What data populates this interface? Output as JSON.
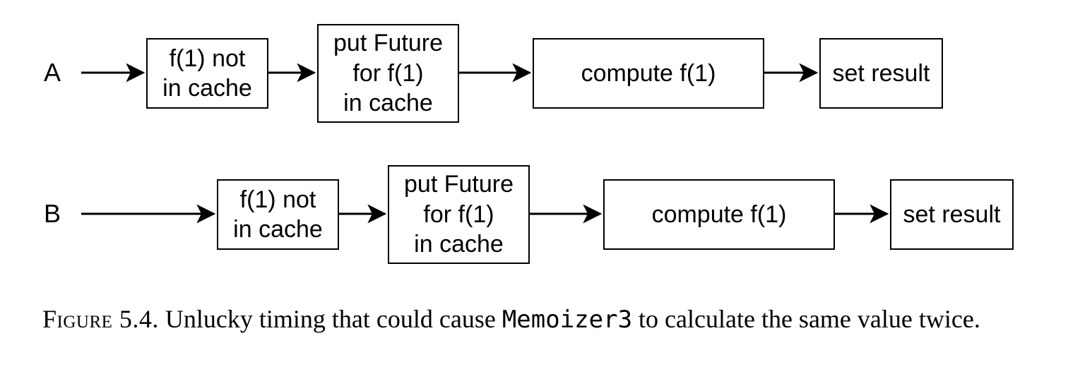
{
  "rows": {
    "a": {
      "label": "A"
    },
    "b": {
      "label": "B"
    }
  },
  "boxes": {
    "a_check": "f(1) not\nin cache",
    "a_put": "put Future\nfor f(1)\nin cache",
    "a_compute": "compute f(1)",
    "a_set": "set result",
    "b_check": "f(1) not\nin cache",
    "b_put": "put Future\nfor f(1)\nin cache",
    "b_compute": "compute f(1)",
    "b_set": "set result"
  },
  "caption": {
    "figure_label": "Figure 5.4.",
    "pre": "  Unlucky timing that could cause ",
    "code": "Memoizer3",
    "post": " to calculate the same value twice."
  }
}
